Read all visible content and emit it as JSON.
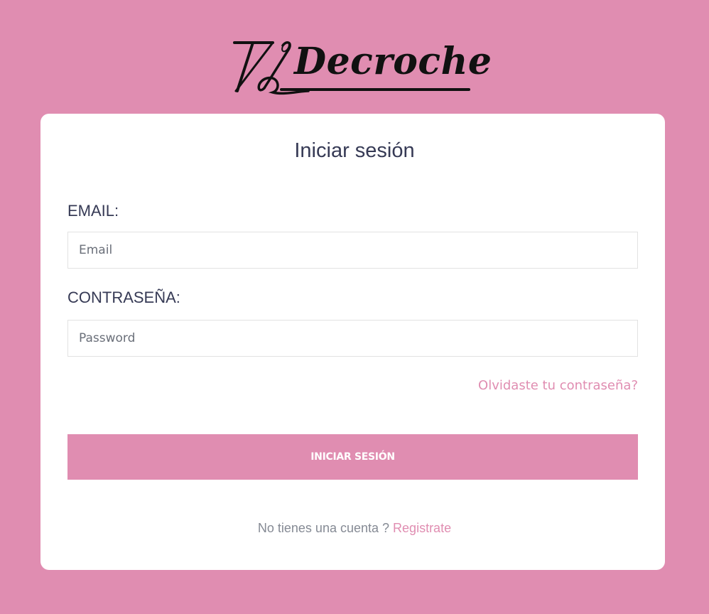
{
  "brand": {
    "name": "Decroche"
  },
  "login": {
    "title": "Iniciar sesión",
    "email_label": "EMAIL:",
    "email_placeholder": "Email",
    "email_value": "",
    "password_label": "CONTRASEÑA:",
    "password_placeholder": "Password",
    "password_value": "",
    "forgot_label": "Olvidaste tu contraseña?",
    "submit_label": "INICIAR SESIÓN",
    "no_account_text": "No tienes una cuenta ?",
    "register_label": "Registrate"
  },
  "colors": {
    "background": "#e08db1",
    "card": "#ffffff",
    "heading": "#363a55",
    "accent": "#e08db1",
    "muted_text": "#858a94"
  },
  "icons": {
    "logo_mark": "crochet-needle-icon"
  }
}
